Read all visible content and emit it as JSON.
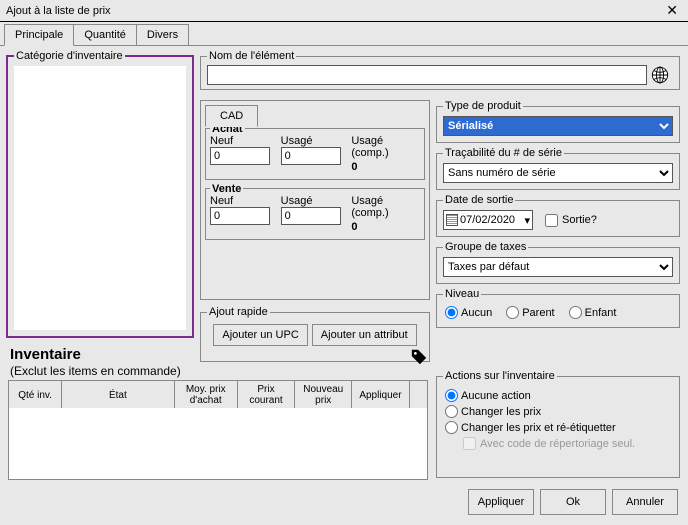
{
  "window": {
    "title": "Ajout à la liste de prix"
  },
  "tabs": [
    "Principale",
    "Quantité",
    "Divers"
  ],
  "activeTab": 0,
  "category": {
    "label": "Catégorie d'inventaire"
  },
  "element_name": {
    "label": "Nom de l'élément",
    "value": ""
  },
  "currency_tab": "CAD",
  "achat": {
    "title": "Achat",
    "neuf_label": "Neuf",
    "neuf_value": "0",
    "usage_label": "Usagé",
    "usage_value": "0",
    "usage_comp_label": "Usagé (comp.)",
    "usage_comp_value": "0"
  },
  "vente": {
    "title": "Vente",
    "neuf_label": "Neuf",
    "neuf_value": "0",
    "usage_label": "Usagé",
    "usage_value": "0",
    "usage_comp_label": "Usagé (comp.)",
    "usage_comp_value": "0"
  },
  "quick_add": {
    "title": "Ajout rapide",
    "upc_btn": "Ajouter un UPC",
    "attr_btn": "Ajouter un attribut"
  },
  "product_type": {
    "title": "Type de produit",
    "value": "Sérialisé"
  },
  "serial_trace": {
    "title": "Traçabilité du # de série",
    "value": "Sans numéro de série"
  },
  "release": {
    "title": "Date de sortie",
    "date": "07/02/2020",
    "sortie_label": "Sortie?",
    "sortie_checked": false
  },
  "tax_group": {
    "title": "Groupe de taxes",
    "value": "Taxes par défaut"
  },
  "level": {
    "title": "Niveau",
    "options": [
      "Aucun",
      "Parent",
      "Enfant"
    ],
    "selected": 0
  },
  "inventory": {
    "title": "Inventaire",
    "subtitle": "(Exclut les items en commande)",
    "headers": [
      "Qté inv.",
      "État",
      "Moy. prix d'achat",
      "Prix courant",
      "Nouveau prix",
      "Appliquer"
    ]
  },
  "inv_actions": {
    "title": "Actions sur l'inventaire",
    "options": [
      "Aucune action",
      "Changer les prix",
      "Changer les prix et ré-étiquetter"
    ],
    "selected": 0,
    "slot_code_label": "Avec code de répertoriage seul."
  },
  "dialog_buttons": {
    "apply": "Appliquer",
    "ok": "Ok",
    "cancel": "Annuler"
  }
}
